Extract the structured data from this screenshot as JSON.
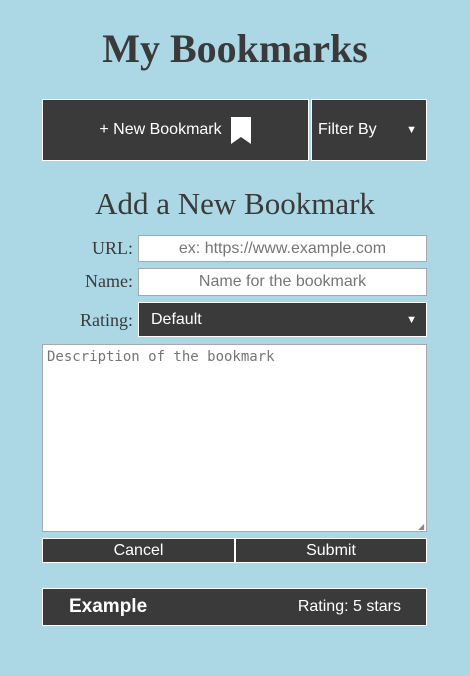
{
  "header": {
    "title": "My Bookmarks"
  },
  "toolbar": {
    "new_bookmark_label": "+ New Bookmark",
    "filter_label": "Filter By"
  },
  "form": {
    "heading": "Add a New Bookmark",
    "url_label": "URL:",
    "url_placeholder": "ex: https://www.example.com",
    "name_label": "Name:",
    "name_placeholder": "Name for the bookmark",
    "rating_label": "Rating:",
    "rating_value": "Default",
    "description_placeholder": "Description of the bookmark",
    "cancel_label": "Cancel",
    "submit_label": "Submit"
  },
  "bookmarks": [
    {
      "name": "Example",
      "rating": "Rating: 5 stars"
    }
  ],
  "colors": {
    "background": "#acd8e6",
    "dark": "#3a3a3a",
    "text": "#3a3a3a"
  },
  "icons": {
    "new_bookmark": "bookmark-icon",
    "dropdown": "chevron-down-icon"
  }
}
